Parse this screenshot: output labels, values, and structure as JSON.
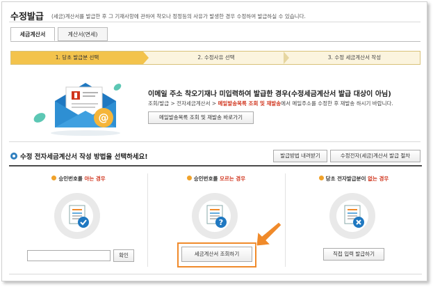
{
  "header": {
    "title": "수정발급",
    "description": "(세금)계산서를 발급한 후 그 기재사항에 관하여 착오나 정정등의 사유가 발생한 경우 수정하여 발급하실 수 있습니다."
  },
  "tabs": [
    {
      "label": "세금계산서",
      "active": true
    },
    {
      "label": "계산서(면세)",
      "active": false
    }
  ],
  "steps": [
    {
      "label": "1. 당초 발급분 선택",
      "active": true
    },
    {
      "label": "2. 수정사유 선택",
      "active": false
    },
    {
      "label": "3. 수정 세금계산서 작성",
      "active": false
    }
  ],
  "notice": {
    "title": "이메일 주소 착오기재나 미입력하여 발급한 경우(수정세금계산서 발급 대상이 아님)",
    "path_prefix": "조회/발급 > 전자세금계산서 > ",
    "path_highlight": "메일발송목록 조회 및 재발송",
    "path_suffix": "에서 메일주소를 수정한 후 재발송 하시기 바랍니다.",
    "button_label": "메일발송목록 조회 및 재발송 바로가기"
  },
  "section": {
    "title": "수정 전자세금계산서 작성 방법을 선택하세요!",
    "download_button": "발급방법 내려받기",
    "procedure_button": "수정전자(세금)계산서 발급 절차"
  },
  "columns": [
    {
      "prefix": "승인번호를 ",
      "highlight": "아는 경우",
      "suffix": "",
      "icon": "document-check-icon",
      "input_value": "",
      "button_label": "확인"
    },
    {
      "prefix": "승인번호를 ",
      "highlight": "모르는 경우",
      "suffix": "",
      "icon": "document-question-icon",
      "button_label": "세금계산서 조회하기"
    },
    {
      "prefix": "당초 전자발급분이 ",
      "highlight": "없는 경우",
      "suffix": "",
      "icon": "document-x-icon",
      "button_label": "직접 입력 발급하기"
    }
  ],
  "colors": {
    "accent_orange": "#f3c34c",
    "highlight_red": "#d0341c",
    "callout_orange": "#f08a2a",
    "envelope_blue": "#2e8fd3"
  }
}
